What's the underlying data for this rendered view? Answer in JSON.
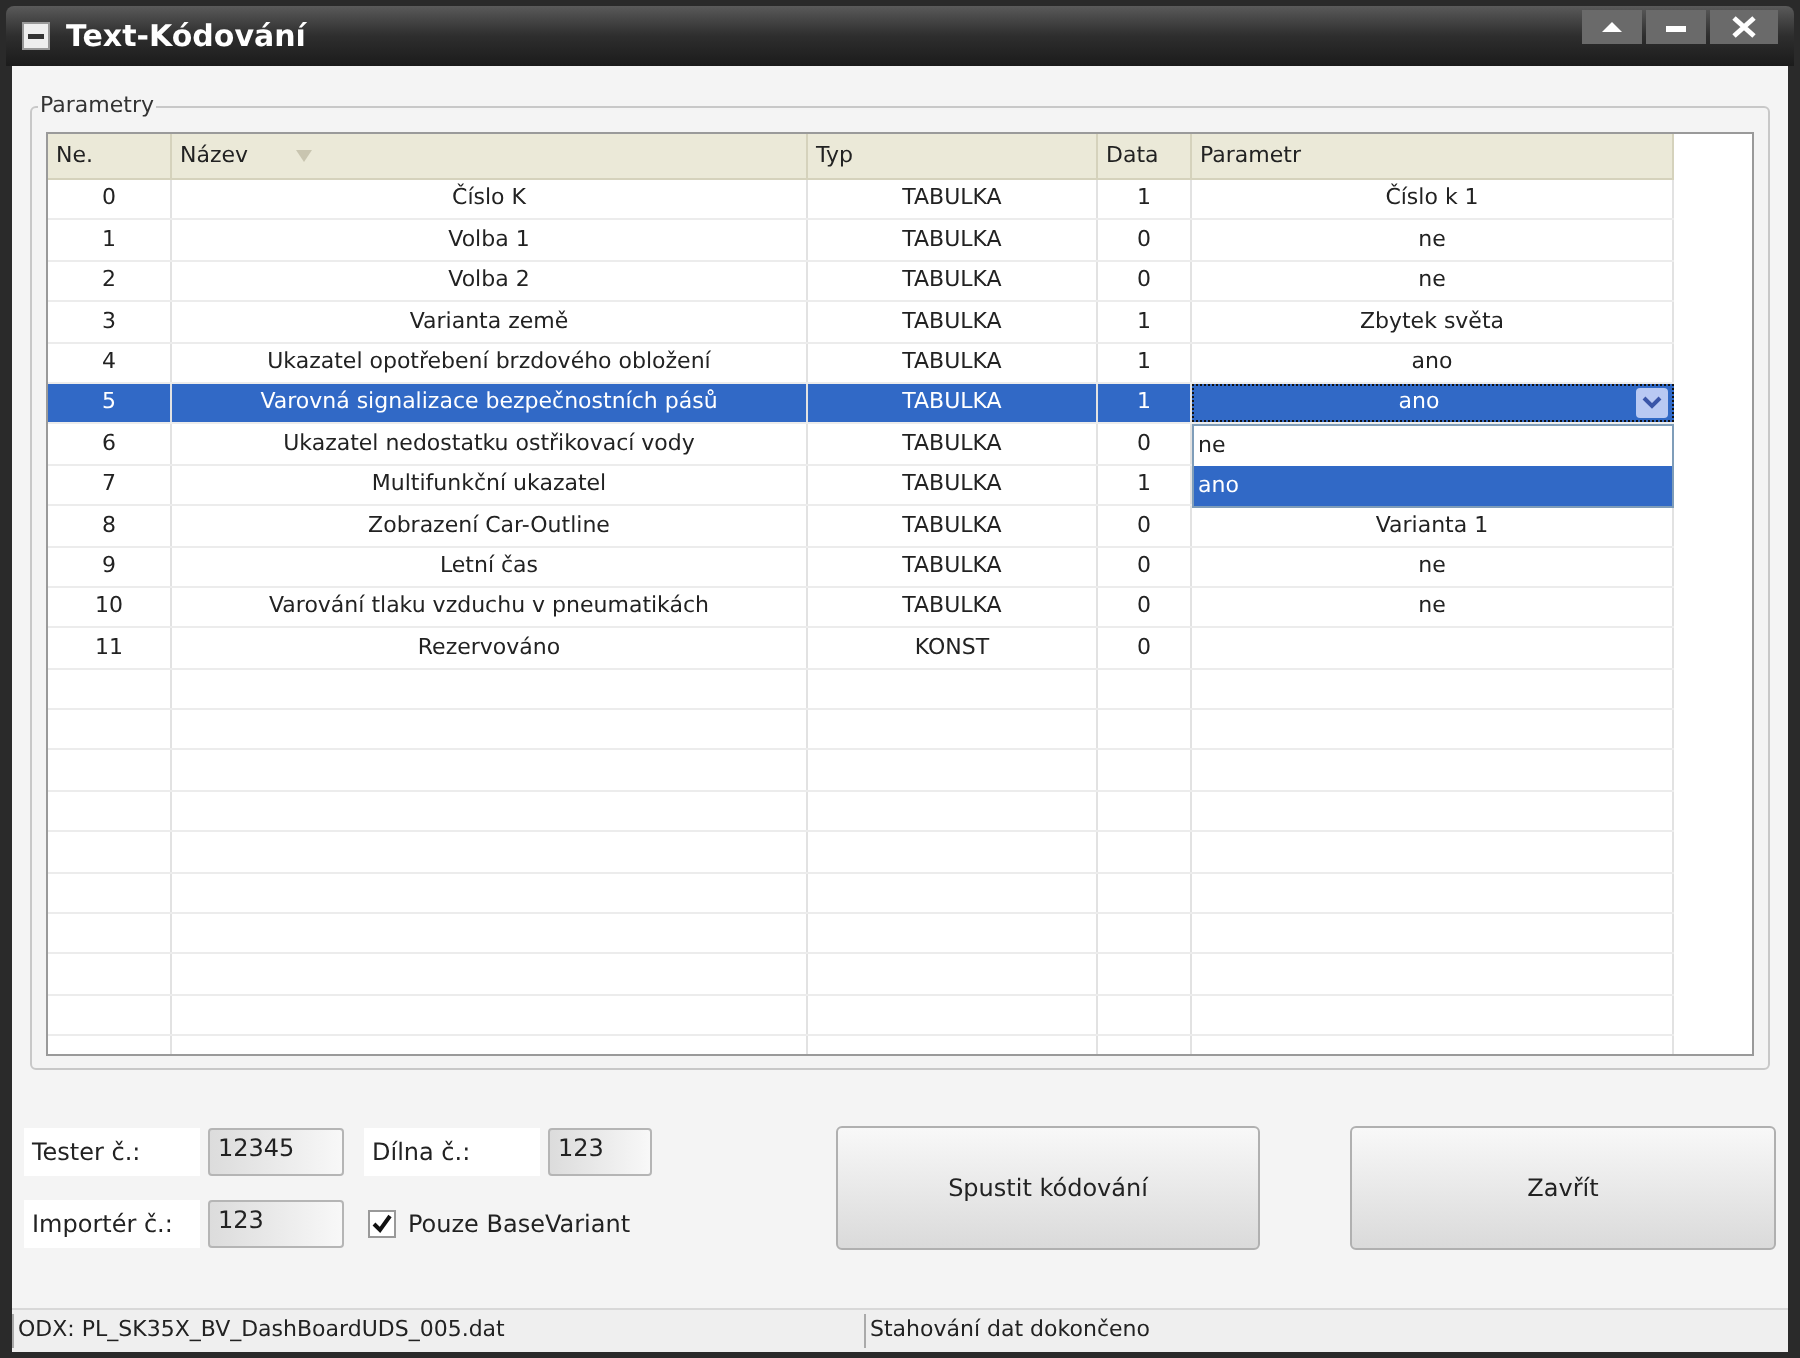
{
  "window": {
    "title": "Text-Kódování"
  },
  "group": {
    "title": "Parametry"
  },
  "table": {
    "columns": [
      {
        "label": "Ne."
      },
      {
        "label": "Název",
        "sort_icon": true
      },
      {
        "label": "Typ"
      },
      {
        "label": "Data"
      },
      {
        "label": "Parametr"
      }
    ],
    "rows": [
      {
        "no": "0",
        "name": "Číslo K",
        "type": "TABULKA",
        "data": "1",
        "param": "Číslo k 1",
        "selected": false
      },
      {
        "no": "1",
        "name": "Volba 1",
        "type": "TABULKA",
        "data": "0",
        "param": "ne",
        "selected": false
      },
      {
        "no": "2",
        "name": "Volba 2",
        "type": "TABULKA",
        "data": "0",
        "param": "ne",
        "selected": false
      },
      {
        "no": "3",
        "name": "Varianta země",
        "type": "TABULKA",
        "data": "1",
        "param": "Zbytek světa",
        "selected": false
      },
      {
        "no": "4",
        "name": "Ukazatel opotřebení brzdového obložení",
        "type": "TABULKA",
        "data": "1",
        "param": "ano",
        "selected": false
      },
      {
        "no": "5",
        "name": "Varovná signalizace bezpečnostních pásů",
        "type": "TABULKA",
        "data": "1",
        "param": "ano",
        "selected": true,
        "editor": {
          "options": [
            {
              "label": "ne",
              "selected": false
            },
            {
              "label": "ano",
              "selected": true
            }
          ]
        }
      },
      {
        "no": "6",
        "name": "Ukazatel nedostatku ostřikovací vody",
        "type": "TABULKA",
        "data": "0",
        "selected": false
      },
      {
        "no": "7",
        "name": "Multifunkční ukazatel",
        "type": "TABULKA",
        "data": "1",
        "selected": false
      },
      {
        "no": "8",
        "name": "Zobrazení Car-Outline",
        "type": "TABULKA",
        "data": "0",
        "param": "Varianta 1",
        "selected": false
      },
      {
        "no": "9",
        "name": "Letní čas",
        "type": "TABULKA",
        "data": "0",
        "param": "ne",
        "selected": false
      },
      {
        "no": "10",
        "name": "Varování tlaku vzduchu v pneumatikách",
        "type": "TABULKA",
        "data": "0",
        "param": "ne",
        "selected": false
      },
      {
        "no": "11",
        "name": "Rezervováno",
        "type": "KONST",
        "data": "0",
        "selected": false
      }
    ]
  },
  "fields": [
    {
      "label": "Tester č.:",
      "value": "12345"
    },
    {
      "label": "Dílna č.:",
      "value": "123"
    },
    {
      "label": "Importér č.:",
      "value": "123"
    }
  ],
  "checkbox": {
    "label": "Pouze BaseVariant",
    "checked": true
  },
  "buttons": [
    "Spustit kódování",
    "Zavřít"
  ],
  "status_bar": [
    "ODX: PL_SK35X_BV_DashBoardUDS_005.dat",
    "Stahování dat dokončeno"
  ]
}
